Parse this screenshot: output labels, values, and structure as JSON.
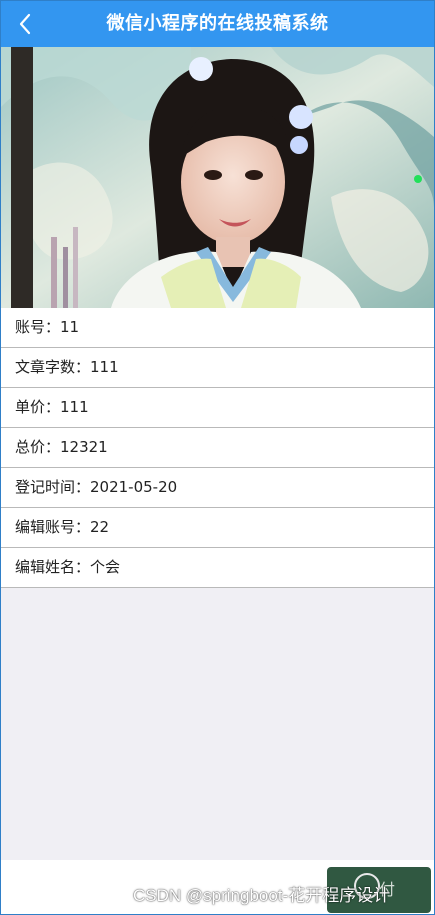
{
  "navbar": {
    "title": "微信小程序的在线投稿系统",
    "back_icon": "chevron-left-icon",
    "background": "#3396f0"
  },
  "hero": {
    "image": "photo-of-woman-in-traditional-costume"
  },
  "details": [
    "账号：11",
    "文章字数：111",
    "单价：111",
    "总价：12321",
    "登记时间：2021-05-20",
    "编辑账号：22",
    "编辑姓名：个会"
  ],
  "floating_button": {
    "label": "付"
  },
  "watermark": "CSDN @springboot-花开程序设计"
}
